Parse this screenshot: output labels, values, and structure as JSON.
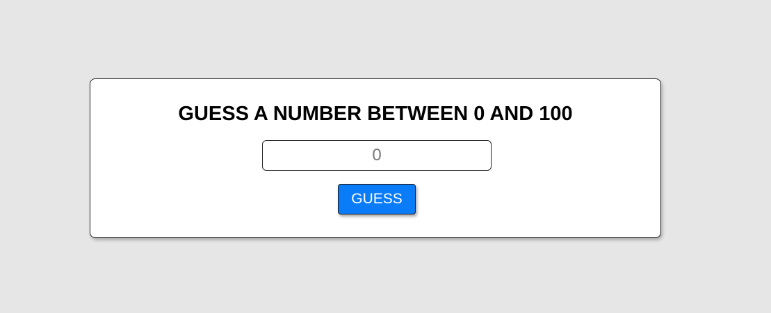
{
  "game": {
    "title": "GUESS A NUMBER BETWEEN 0 AND 100",
    "input": {
      "placeholder": "0",
      "value": ""
    },
    "guess_button_label": "GUESS"
  },
  "colors": {
    "background": "#e6e6e6",
    "card": "#ffffff",
    "button": "#0a7cf7",
    "button_text": "#ffffff"
  }
}
